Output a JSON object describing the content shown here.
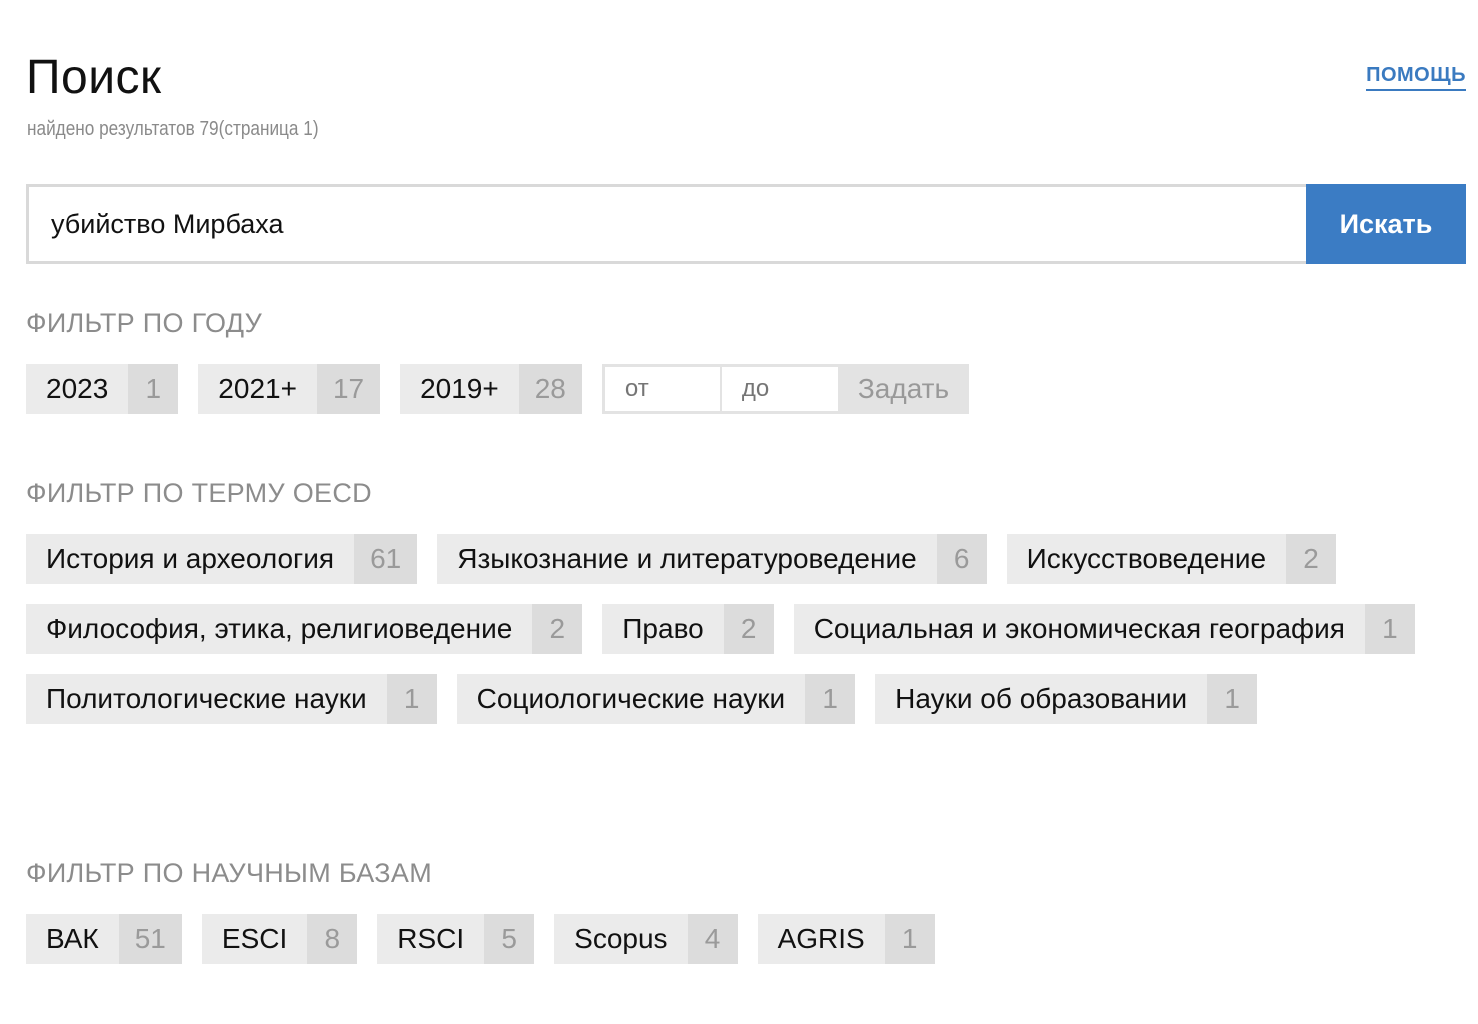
{
  "header": {
    "title": "Поиск",
    "subtitle": "найдено результатов 79(страница 1)",
    "help_label": "ПОМОЩЬ"
  },
  "search": {
    "value": "убийство Мирбаха",
    "button_label": "Искать"
  },
  "year_filter": {
    "heading": "ФИЛЬТР ПО ГОДУ",
    "items": [
      {
        "label": "2023",
        "count": "1"
      },
      {
        "label": "2021+",
        "count": "17"
      },
      {
        "label": "2019+",
        "count": "28"
      }
    ],
    "from_placeholder": "от",
    "to_placeholder": "до",
    "apply_label": "Задать"
  },
  "oecd_filter": {
    "heading": "ФИЛЬТР ПО ТЕРМУ OECD",
    "items": [
      {
        "label": "История и археология",
        "count": "61"
      },
      {
        "label": "Языкознание и литературоведение",
        "count": "6"
      },
      {
        "label": "Искусствоведение",
        "count": "2"
      },
      {
        "label": "Философия, этика, религиоведение",
        "count": "2"
      },
      {
        "label": "Право",
        "count": "2"
      },
      {
        "label": "Социальная и экономическая география",
        "count": "1"
      },
      {
        "label": "Политологические науки",
        "count": "1"
      },
      {
        "label": "Социологические науки",
        "count": "1"
      },
      {
        "label": "Науки об образовании",
        "count": "1"
      }
    ]
  },
  "db_filter": {
    "heading": "ФИЛЬТР ПО НАУЧНЫМ БАЗАМ",
    "items": [
      {
        "label": "ВАК",
        "count": "51"
      },
      {
        "label": "ESCI",
        "count": "8"
      },
      {
        "label": "RSCI",
        "count": "5"
      },
      {
        "label": "Scopus",
        "count": "4"
      },
      {
        "label": "AGRIS",
        "count": "1"
      }
    ]
  },
  "colors": {
    "accent": "#3b7cc4",
    "chip_bg": "#ebebeb",
    "chip_count_bg": "#dcdcdc",
    "heading": "#8c8c8c"
  }
}
